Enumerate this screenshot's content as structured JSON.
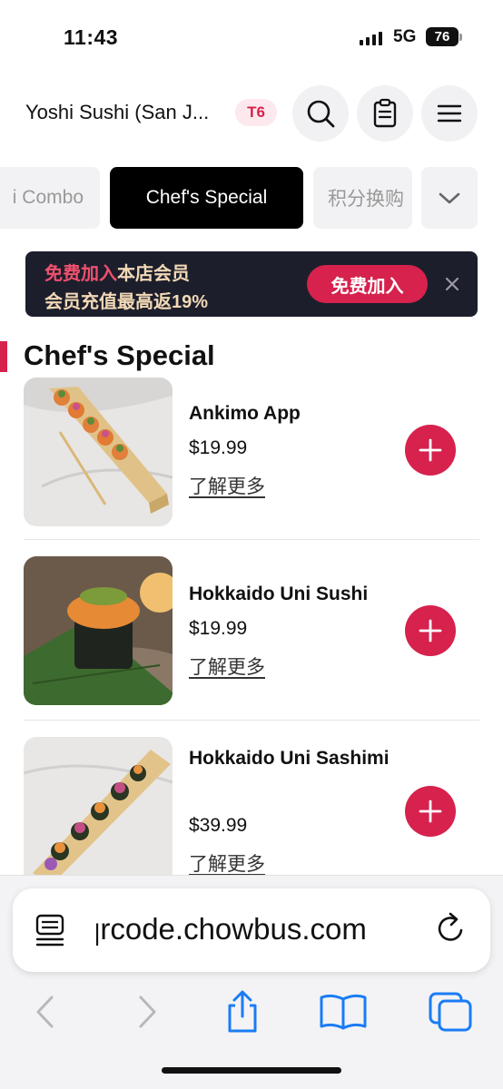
{
  "status_bar": {
    "time": "11:43",
    "network": "5G",
    "battery": "76"
  },
  "header": {
    "store_name": "Yoshi Sushi (San J...",
    "table_badge": "T6",
    "icons": [
      "search-icon",
      "order-list-icon",
      "menu-icon"
    ]
  },
  "tabs": [
    {
      "label": "i Combo",
      "active": false
    },
    {
      "label": "Chef's Special",
      "active": true
    },
    {
      "label": "积分换购",
      "active": false
    }
  ],
  "promo": {
    "highlight": "免费加入",
    "line1_rest": "本店会员",
    "line2": "会员充值最高返19%",
    "join_label": "免费加入"
  },
  "section": {
    "title": "Chef's Special"
  },
  "menu_items": [
    {
      "name": "Ankimo App",
      "price": "$19.99",
      "more": "了解更多"
    },
    {
      "name": "Hokkaido Uni Sushi",
      "price": "$19.99",
      "more": "了解更多"
    },
    {
      "name": "Hokkaido Uni Sashimi",
      "price": "$39.99",
      "more": "了解更多"
    }
  ],
  "browser": {
    "url": "qrcode.chowbus.com"
  },
  "colors": {
    "accent": "#d6224d",
    "banner_bg": "#1c1e2c",
    "banner_text": "#f2d9b6",
    "ios_blue": "#1a7cf5"
  }
}
